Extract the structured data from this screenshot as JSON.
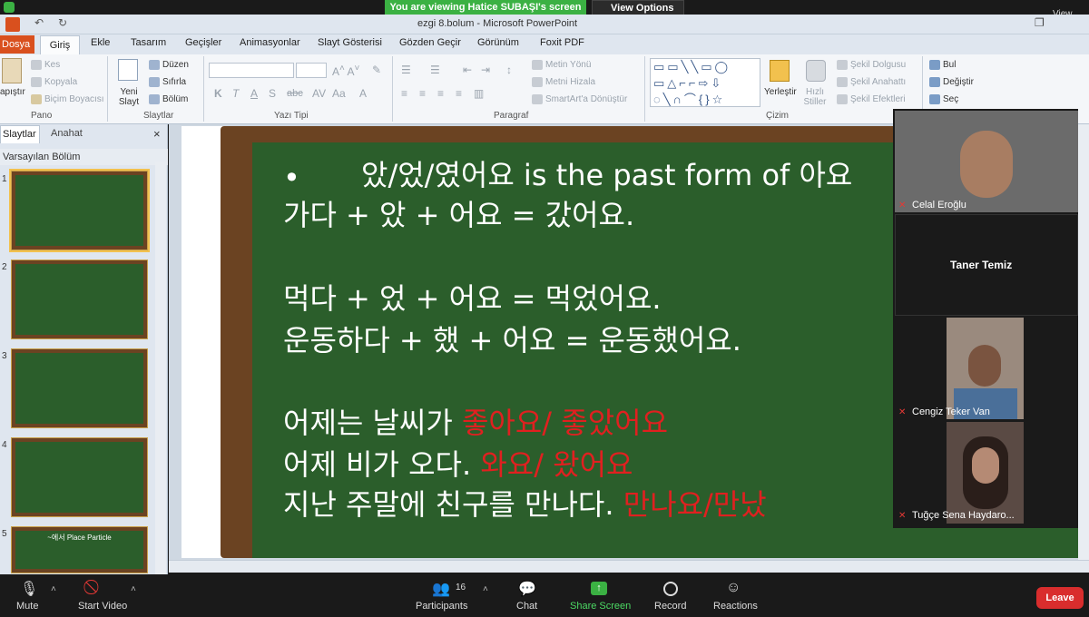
{
  "zoom": {
    "banner": "You are viewing Hatice SUBAŞI's screen",
    "view_options": "View Options",
    "view_right": "View",
    "toolbar": {
      "mute": "Mute",
      "start_video": "Start Video",
      "participants": "Participants",
      "participants_count": "16",
      "chat": "Chat",
      "share_screen": "Share Screen",
      "record": "Record",
      "reactions": "Reactions",
      "leave": "Leave"
    },
    "participants": [
      {
        "name": "Celal Eroğlu"
      },
      {
        "name": "Taner Temiz"
      },
      {
        "name": "Cengiz Teker Van"
      },
      {
        "name": "Tuğçe Sena Haydaro..."
      }
    ]
  },
  "ppt": {
    "window_title": "ezgi 8.bolum  -  Microsoft PowerPoint",
    "tabs": [
      "Dosya",
      "Giriş",
      "Ekle",
      "Tasarım",
      "Geçişler",
      "Animasyonlar",
      "Slayt Gösterisi",
      "Gözden Geçir",
      "Görünüm",
      "Foxit PDF"
    ],
    "ribbon": {
      "pano": {
        "label": "Pano",
        "paste": "apıştır",
        "cut": "Kes",
        "copy": "Kopyala",
        "format_painter": "Biçim Boyacısı"
      },
      "slaytlar": {
        "label": "Slaytlar",
        "new_slide": "Yeni Slayt",
        "layout": "Düzen",
        "reset": "Sıfırla",
        "section": "Bölüm"
      },
      "yazi_tipi": {
        "label": "Yazı Tipi",
        "bold": "K",
        "italic": "T",
        "underline": "A",
        "strike": "S",
        "shadow": "abc"
      },
      "paragraf": {
        "label": "Paragraf",
        "text_direction": "Metin Yönü",
        "align_text": "Metni Hizala",
        "smartart": "SmartArt'a Dönüştür"
      },
      "cizim": {
        "label": "Çizim",
        "arrange": "Yerleştir",
        "quick_styles": "Hızlı Stiller",
        "fill": "Şekil Dolgusu",
        "outline": "Şekil Anahattı",
        "effects": "Şekil Efektleri"
      },
      "duzenleme": {
        "find": "Bul",
        "replace": "Değiştir",
        "select": "Seç"
      }
    },
    "panel": {
      "tab_slides": "Slaytlar",
      "tab_outline": "Anahat",
      "section": "Varsayılan Bölüm",
      "slide_numbers": [
        "1",
        "2",
        "3",
        "4",
        "5"
      ],
      "thumb5_title": "~에서 Place Particle"
    },
    "slide": {
      "bullet": "•",
      "line1_a": "았/었/였어요 is the ",
      "line1_b": "past form of 아요",
      "line2": "가다 + 았 + 어요 = 갔어요.",
      "line3": "먹다 + 었 + 어요 = 먹었어요.",
      "line4": "운동하다 + 했 + 어요 = 운동했어요.",
      "line5_white": "어제는 날씨가 ",
      "line5_red": "좋아요/ 좋았어요",
      "line6_white": "어제 비가 오다. ",
      "line6_red": "와요/ 왔어요",
      "line7_white": "지난 주말에 친구를 만나다. ",
      "line7_red": "만나요/만났"
    }
  },
  "colors": {
    "board_green": "#2b5e2b",
    "board_frame": "#6b4322",
    "slide_red": "#e02020",
    "zoom_green": "#3bb143",
    "leave_red": "#d92d2d"
  }
}
